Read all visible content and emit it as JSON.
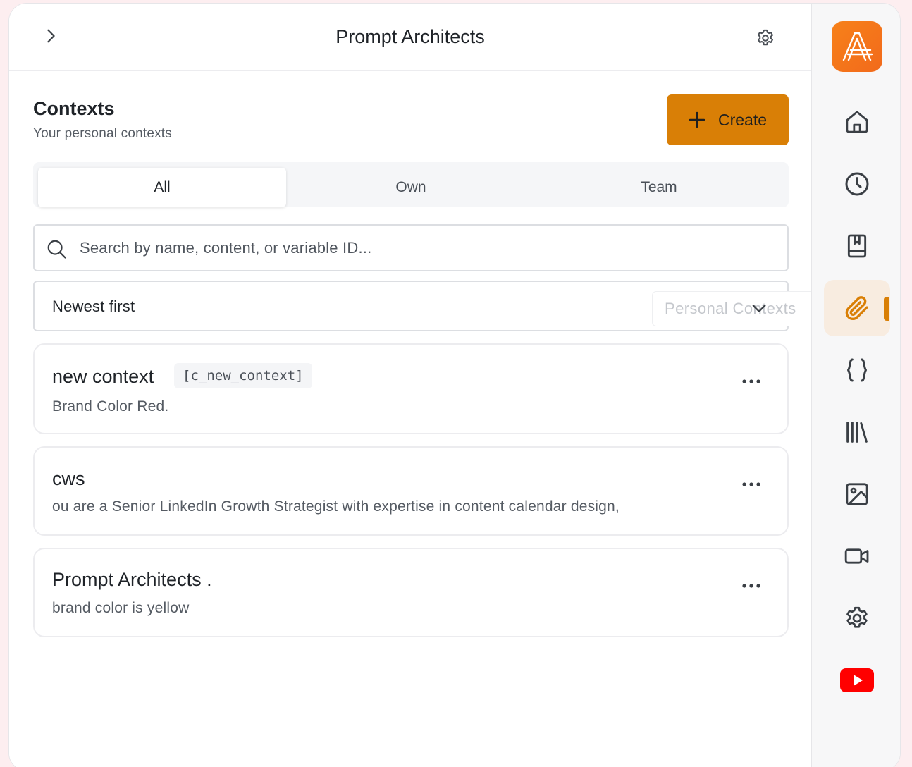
{
  "header": {
    "title": "Prompt Architects",
    "expand_icon": "chevron-right-icon",
    "settings_icon": "gear-icon"
  },
  "section": {
    "title": "Contexts",
    "subtitle": "Your personal contexts",
    "create_label": "Create"
  },
  "tabs": [
    {
      "label": "All",
      "active": true
    },
    {
      "label": "Own",
      "active": false
    },
    {
      "label": "Team",
      "active": false
    }
  ],
  "search": {
    "placeholder": "Search by name, content, or variable ID...",
    "value": ""
  },
  "sort": {
    "selected": "Newest first"
  },
  "tooltip": "Personal Contexts",
  "contexts": [
    {
      "title": "new context",
      "tag": "[c_new_context]",
      "description": "Brand Color Red."
    },
    {
      "title": "cws",
      "tag": "",
      "description": "ou are a Senior LinkedIn Growth Strategist with expertise in content calendar design,"
    },
    {
      "title": "Prompt Architects .",
      "tag": "",
      "description": "brand color is yellow"
    }
  ],
  "rail": {
    "items": [
      "home-icon",
      "history-icon",
      "book-icon",
      "paperclip-icon",
      "braces-icon",
      "library-icon",
      "image-icon",
      "video-icon",
      "settings-icon",
      "youtube-icon"
    ],
    "active": "paperclip-icon"
  },
  "colors": {
    "accent": "#d97f06",
    "logo": "#f7811a",
    "youtube": "#ff0000"
  }
}
